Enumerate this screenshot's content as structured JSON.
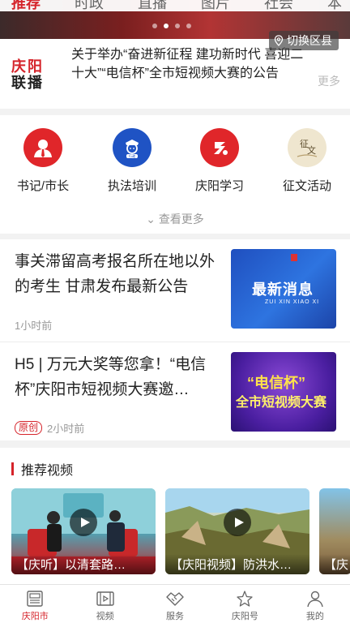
{
  "top_tabs": [
    "推荐",
    "时政",
    "直播",
    "图片",
    "社会",
    "本"
  ],
  "switch_county_label": "切换区县",
  "headline": {
    "logo_line1": "庆阳",
    "logo_line2": "联播",
    "text": "关于举办“奋进新征程 建功新时代 喜迎二十大”“电信杯”全市短视频大赛的公告",
    "more": "更多"
  },
  "grid": {
    "items": [
      {
        "label": "书记/市长",
        "color": "#e0262a"
      },
      {
        "label": "执法培训",
        "color": "#1f53c4"
      },
      {
        "label": "庆阳学习",
        "color": "#e0262a"
      },
      {
        "label": "征文活动",
        "color": "#e8dcc0"
      }
    ],
    "see_more": "查看更多"
  },
  "news": [
    {
      "title": "事关滞留高考报名所在地以外的考生 甘肃发布最新公告",
      "time": "1小时前",
      "badge": "",
      "thumb_main": "最新消息",
      "thumb_sub": "ZUI XIN XIAO XI"
    },
    {
      "title": "H5 | 万元大奖等您拿！“电信杯”庆阳市短视频大赛邀…",
      "time": "2小时前",
      "badge": "原创",
      "thumb_line1": "“电信杯”",
      "thumb_line2": "全市短视频大赛"
    }
  ],
  "videos": {
    "section_title": "推荐视频",
    "items": [
      {
        "caption": "【庆听】以清套路…"
      },
      {
        "caption": "【庆阳视频】防洪水…"
      },
      {
        "caption": "【庆"
      }
    ]
  },
  "bottom_nav": [
    {
      "label": "庆阳市",
      "icon": "newspaper-icon",
      "active": true
    },
    {
      "label": "视频",
      "icon": "film-icon",
      "active": false
    },
    {
      "label": "服务",
      "icon": "handshake-icon",
      "active": false
    },
    {
      "label": "庆阳号",
      "icon": "star-icon",
      "active": false
    },
    {
      "label": "我的",
      "icon": "person-icon",
      "active": false
    }
  ]
}
